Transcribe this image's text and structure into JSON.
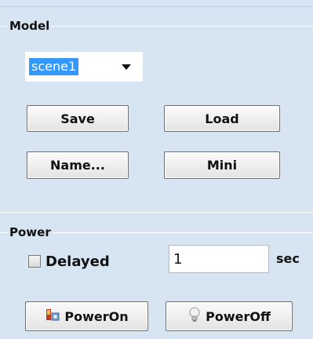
{
  "model": {
    "title": "Model",
    "scene_select": {
      "value": "scene1"
    },
    "buttons": {
      "save": "Save",
      "load": "Load",
      "name": "Name...",
      "mini": "Mini"
    }
  },
  "power": {
    "title": "Power",
    "delayed": {
      "label": "Delayed",
      "checked": false
    },
    "delay_input": {
      "value": "1"
    },
    "unit": "sec",
    "buttons": {
      "power_on": "PowerOn",
      "power_off": "PowerOff"
    },
    "icons": {
      "power_on": "power-on-icon",
      "power_off": "lightbulb-icon"
    }
  }
}
